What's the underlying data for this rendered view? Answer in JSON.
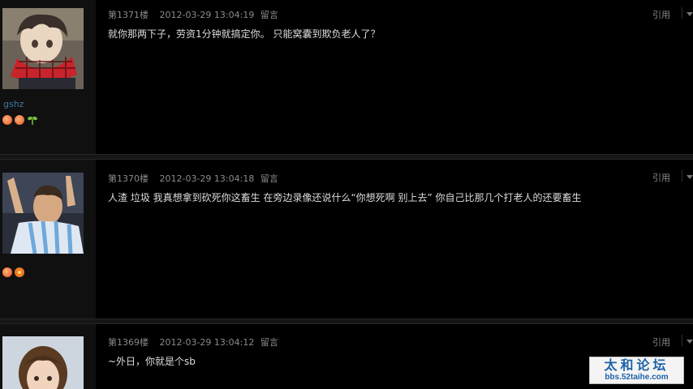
{
  "posts": [
    {
      "floor": "第1371楼",
      "date": "2012-03-29 13:04:19",
      "comment_link": "留言",
      "quote_label": "引用",
      "content": "就你那两下子，劳资1分钟就搞定你。 只能窝囊到欺负老人了？",
      "username": "gshz",
      "medals": [
        "peach-icon",
        "peach-icon",
        "sprout-icon"
      ]
    },
    {
      "floor": "第1370楼",
      "date": "2012-03-29 13:04:18",
      "comment_link": "留言",
      "quote_label": "引用",
      "content": "人渣 垃圾 我真想拿到砍死你这畜生 在旁边录像还说什么“你想死啊 别上去” 你自己比那几个打老人的还要畜生",
      "username": "",
      "medals": [
        "peach-icon",
        "flower-icon"
      ]
    },
    {
      "floor": "第1369楼",
      "date": "2012-03-29 13:04:12",
      "comment_link": "留言",
      "quote_label": "引用",
      "content": "~外日，你就是个sb",
      "username": "",
      "medals": []
    }
  ],
  "watermark": {
    "title": "太和论坛",
    "url": "bbs.52taihe.com"
  },
  "colors": {
    "background": "#000000",
    "sidebar": "#101010",
    "username": "#3b7aa2",
    "meta_text": "#8a8a8a",
    "watermark_blue": "#1d63a8"
  }
}
